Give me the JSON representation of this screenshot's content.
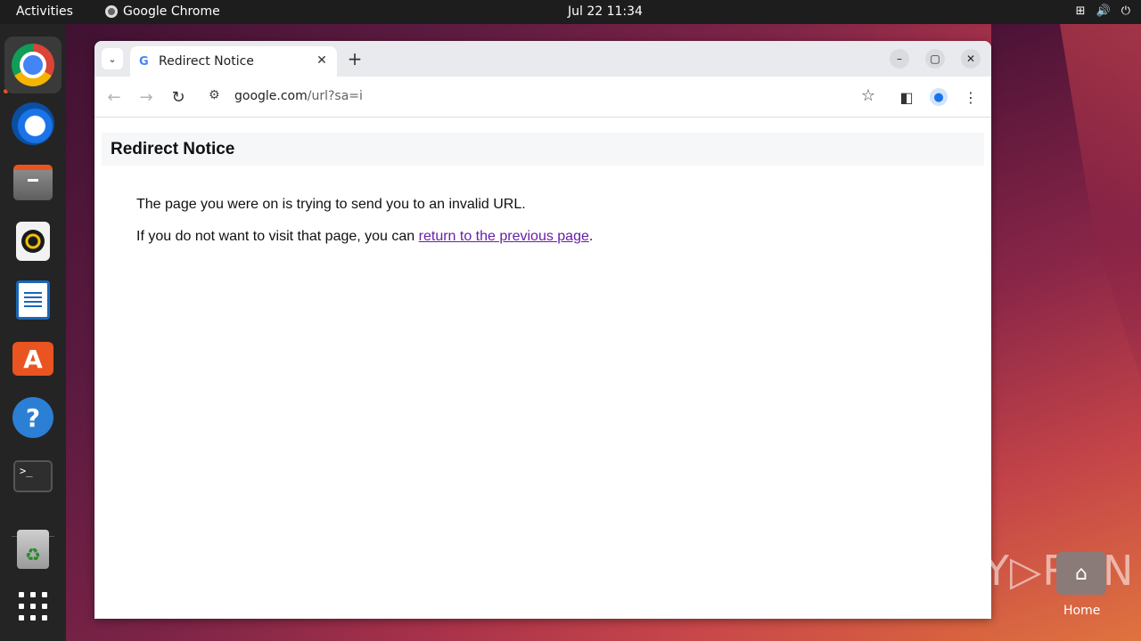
{
  "topbar": {
    "activities": "Activities",
    "app_name": "Google Chrome",
    "clock": "Jul 22  11:34",
    "tray_icons": [
      "network-icon",
      "volume-icon",
      "power-icon"
    ]
  },
  "dock": {
    "items": [
      "chrome",
      "thunderbird",
      "files",
      "rhythmbox",
      "libreoffice-writer",
      "app-center",
      "help",
      "terminal",
      "trash",
      "show-apps"
    ],
    "terminal_glyph": ">_"
  },
  "browser": {
    "tab": {
      "title": "Redirect Notice",
      "favicon": "G"
    },
    "omnibox": {
      "host": "google.com",
      "path": "/url?sa=i"
    }
  },
  "page": {
    "heading": "Redirect Notice",
    "line1": "The page you were on is trying to send you to an invalid URL.",
    "line2_prefix": "If you do not want to visit that page, you can ",
    "line2_link": "return to the previous page",
    "line2_suffix": "."
  },
  "desktop": {
    "watermark": "ANY▷RUN",
    "home_label": "Home"
  },
  "colors": {
    "accent": "#e95420",
    "link_visited": "#681da8",
    "tab_strip": "#e8eaed"
  }
}
